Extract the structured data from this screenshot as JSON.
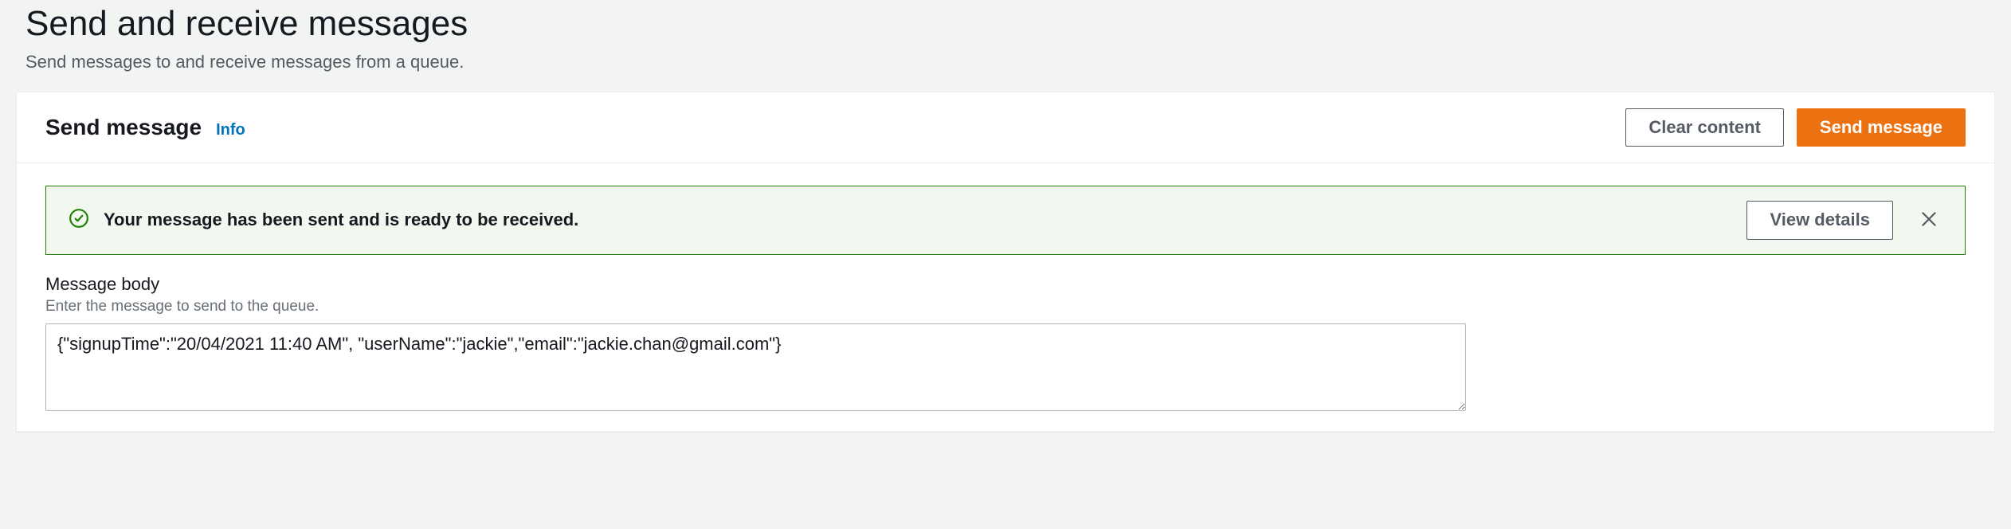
{
  "page": {
    "title": "Send and receive messages",
    "description": "Send messages to and receive messages from a queue."
  },
  "panel": {
    "title": "Send message",
    "info_label": "Info",
    "actions": {
      "clear": "Clear content",
      "send": "Send message"
    }
  },
  "alert": {
    "text": "Your message has been sent and is ready to be received.",
    "view_details": "View details"
  },
  "body_field": {
    "label": "Message body",
    "hint": "Enter the message to send to the queue.",
    "value": "{\"signupTime\":\"20/04/2021 11:40 AM\", \"userName\":\"jackie\",\"email\":\"jackie.chan@gmail.com\"}"
  }
}
